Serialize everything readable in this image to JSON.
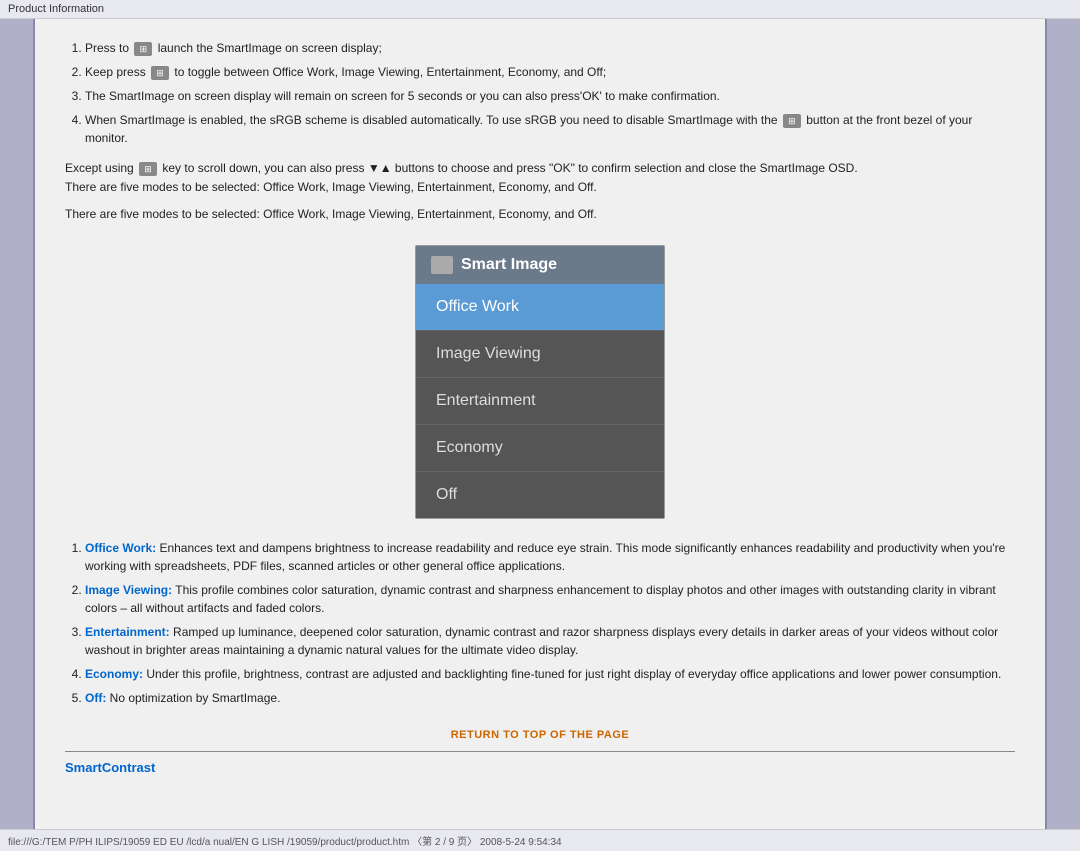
{
  "topbar": {
    "label": "Product Information"
  },
  "steps": [
    {
      "id": 1,
      "text": "Press to",
      "icon": "smartimage-icon",
      "text2": "launch the SmartImage on screen display;"
    },
    {
      "id": 2,
      "text": "Keep press",
      "icon": "smartimage-icon",
      "text2": "to toggle between Office Work, Image Viewing, Entertainment, Economy, and Off;"
    },
    {
      "id": 3,
      "text": "The SmartImage on screen display will remain on screen for 5 seconds or you can also press'OK' to make confirmation."
    },
    {
      "id": 4,
      "text": "When SmartImage is enabled, the sRGB scheme is disabled automatically. To use sRGB you need to disable SmartImage with the",
      "icon": "smartimage-icon",
      "text2": "button at the front bezel of your monitor."
    }
  ],
  "paragraph1": "Except using",
  "paragraph1b": "key to scroll down, you can also press",
  "paragraph1c": "buttons to choose and press \"OK\" to confirm selection and close the SmartImage OSD.",
  "paragraph2": "There are five modes to be selected: Office Work, Image Viewing, Entertainment, Economy, and Off.",
  "paragraph3": "There are five modes to be selected: Office Work, Image Viewing, Entertainment, Economy, and Off.",
  "smartimage": {
    "title": "Smart Image",
    "items": [
      {
        "label": "Office Work",
        "active": true
      },
      {
        "label": "Image Viewing",
        "active": false
      },
      {
        "label": "Entertainment",
        "active": false
      },
      {
        "label": "Economy",
        "active": false
      },
      {
        "label": "Off",
        "active": false
      }
    ]
  },
  "descriptions": [
    {
      "id": 1,
      "bold": "Office Work:",
      "text": " Enhances text and dampens brightness to increase readability and reduce eye strain. This mode significantly enhances readability and productivity when you're working with spreadsheets, PDF files, scanned articles or other general office applications."
    },
    {
      "id": 2,
      "bold": "Image Viewing:",
      "text": " This profile combines color saturation, dynamic contrast and sharpness enhancement to display photos and other images with outstanding clarity in vibrant colors – all without artifacts and faded colors."
    },
    {
      "id": 3,
      "bold": "Entertainment:",
      "text": " Ramped up luminance, deepened color saturation, dynamic contrast and razor sharpness displays every details in darker areas of your videos without color washout in brighter areas maintaining a dynamic natural values for the ultimate video display."
    },
    {
      "id": 4,
      "bold": "Economy:",
      "text": " Under this profile, brightness, contrast are adjusted and backlighting fine-tuned for just right display of everyday office applications and lower power consumption."
    },
    {
      "id": 5,
      "bold": "Off:",
      "text": " No optimization by SmartImage."
    }
  ],
  "return_link": "RETURN TO TOP OF THE PAGE",
  "smart_contrast_label": "SmartContrast",
  "bottombar": "file:///G:/TEM P/PH ILIPS/19059 ED EU /lcd/a nual/EN G LISH /19059/product/product.htm  〈第 2 / 9 页〉 2008-5-24 9:54:34"
}
